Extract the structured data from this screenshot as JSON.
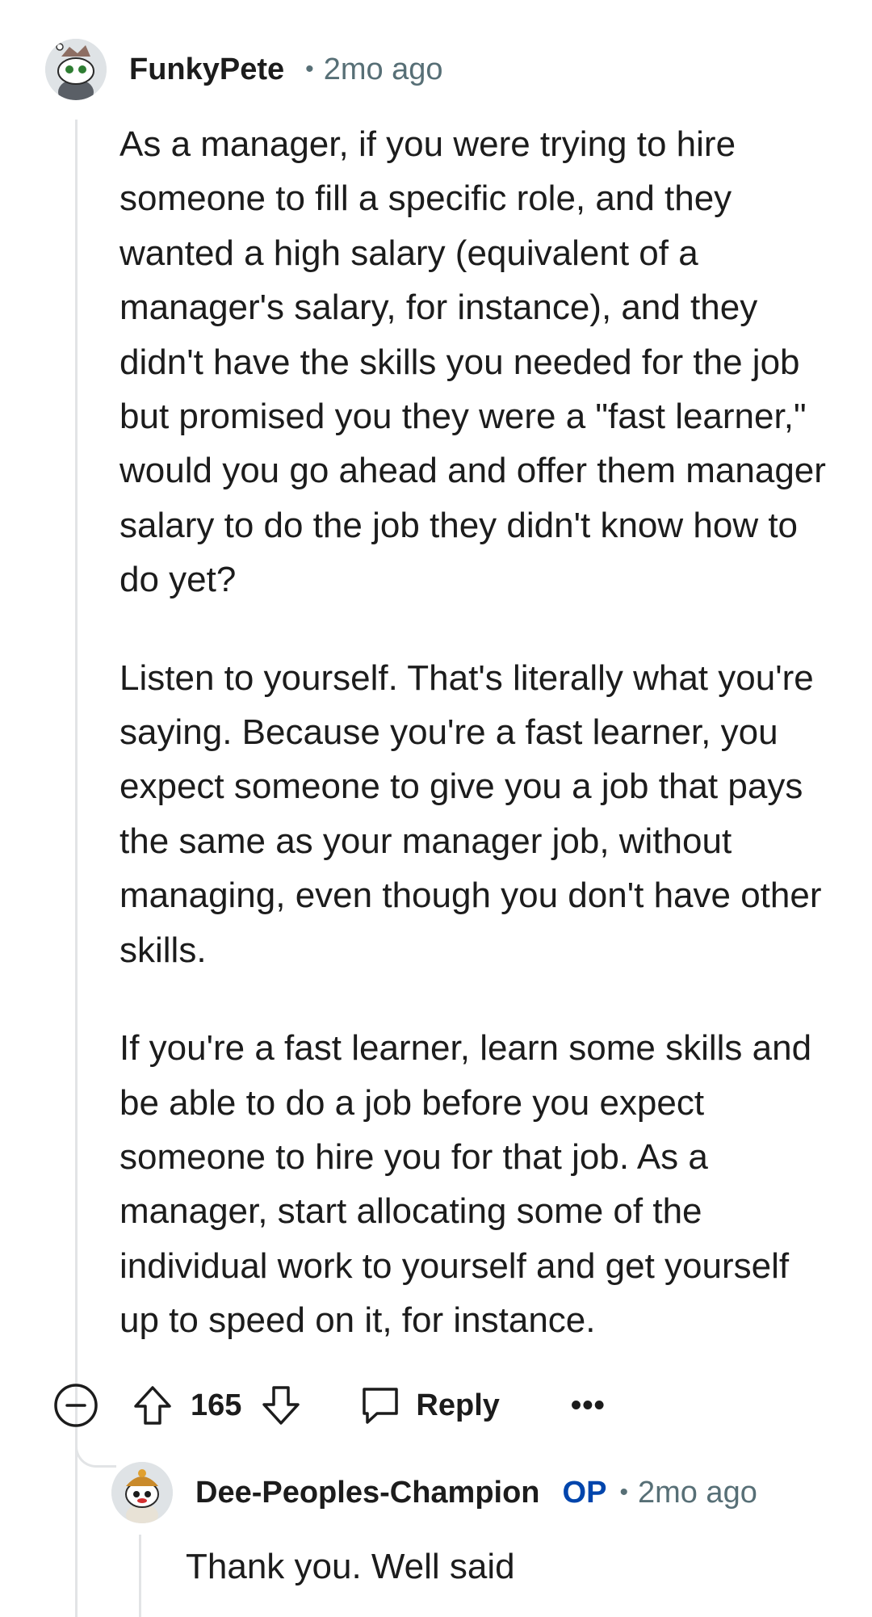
{
  "comment": {
    "username": "FunkyPete",
    "separator": "•",
    "timestamp": "2mo ago",
    "avatar_icon": "reddit-snoo-avatar-icon",
    "paragraphs": [
      "As a manager, if you were trying to hire someone to fill a specific role, and they wanted a high salary (equivalent of a manager's salary, for instance), and they didn't have the skills you needed for the job but promised you they were a \"fast learner,\" would you go ahead and offer them manager salary to do the job they didn't know how to do yet?",
      "Listen to yourself. That's literally what you're saying. Because you're a fast learner, you expect someone to give you a job that pays the same as your manager job, without managing, even though you don't have other skills.",
      "If you're a fast learner, learn some skills and be able to do a job before you expect someone to hire you for that job. As a manager, start allocating some of the individual work to yourself and get yourself up to speed on it, for instance."
    ],
    "actions": {
      "score": "165",
      "reply_label": "Reply",
      "more_label": "•••"
    }
  },
  "reply": {
    "username": "Dee-Peoples-Champion",
    "badge": "OP",
    "separator": "•",
    "timestamp": "2mo ago",
    "avatar_icon": "reddit-snoo-avatar-icon",
    "text": "Thank you. Well said"
  },
  "colors": {
    "text": "#1c1c1c",
    "meta": "#576f76",
    "op_badge": "#0045ac",
    "thread_line": "#e2e4e6"
  }
}
